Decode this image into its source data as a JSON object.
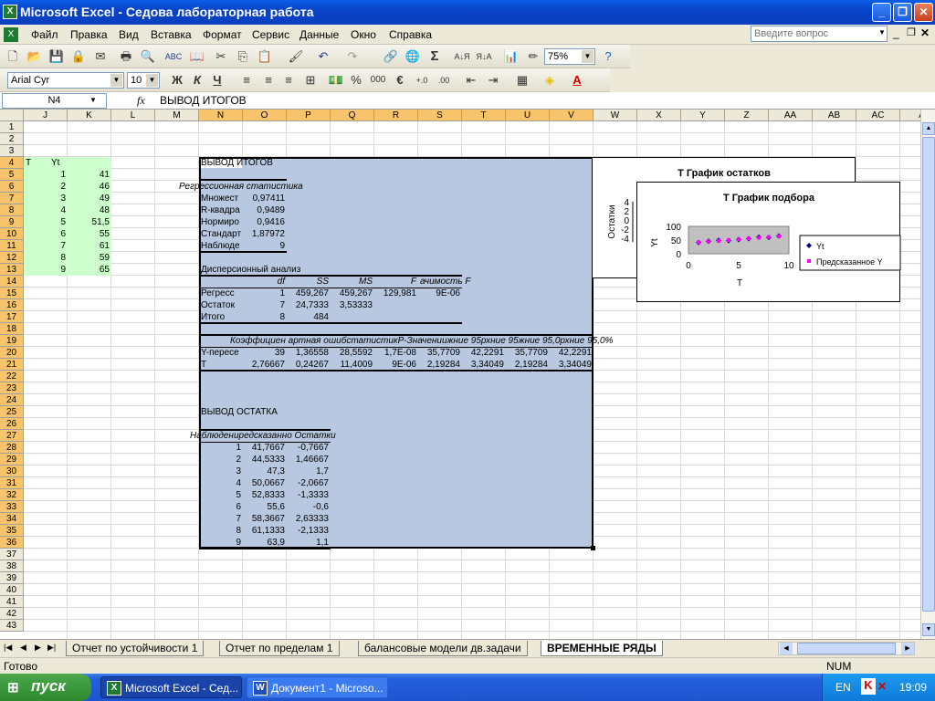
{
  "window": {
    "title": "Microsoft Excel - Седова лабораторная работа"
  },
  "menu": [
    "Файл",
    "Правка",
    "Вид",
    "Вставка",
    "Формат",
    "Сервис",
    "Данные",
    "Окно",
    "Справка"
  ],
  "ask_placeholder": "Введите вопрос",
  "toolbar": {
    "zoom": "75%",
    "font": "Arial Cyr",
    "size": "10",
    "bold": "Ж",
    "italic": "К",
    "underline": "Ч",
    "percent": "%",
    "thousands": "000",
    "euro": "€"
  },
  "formula_bar": {
    "name_box": "N4",
    "fx": "fx",
    "content": "ВЫВОД ИТОГОВ"
  },
  "columns": [
    "J",
    "K",
    "L",
    "M",
    "N",
    "O",
    "P",
    "Q",
    "R",
    "S",
    "T",
    "U",
    "V",
    "W",
    "X",
    "Y",
    "Z",
    "AA",
    "AB",
    "AC",
    "A"
  ],
  "rows": [
    "1",
    "2",
    "3",
    "4",
    "5",
    "6",
    "7",
    "8",
    "9",
    "10",
    "11",
    "12",
    "13",
    "14",
    "15",
    "16",
    "17",
    "18",
    "19",
    "20",
    "21",
    "22",
    "23",
    "24",
    "25",
    "26",
    "27",
    "28",
    "29",
    "30",
    "31",
    "32",
    "33",
    "34",
    "35",
    "36",
    "37",
    "38",
    "39",
    "40",
    "41",
    "42",
    "43"
  ],
  "data_table": {
    "headers": [
      "T",
      "Yt"
    ],
    "T": [
      "1",
      "2",
      "3",
      "4",
      "5",
      "6",
      "7",
      "8",
      "9"
    ],
    "Yt": [
      "41",
      "46",
      "49",
      "48",
      "51,5",
      "55",
      "61",
      "59",
      "65"
    ]
  },
  "output": {
    "title": "ВЫВОД ИТОГОВ",
    "reg_stats_title": "Регрессионная статистика",
    "reg_stats": [
      [
        "Множест",
        "0,97411"
      ],
      [
        "R-квадра",
        "0,9489"
      ],
      [
        "Нормиро",
        "0,9416"
      ],
      [
        "Стандарт",
        "1,87972"
      ],
      [
        "Наблюде",
        "9"
      ]
    ],
    "anova_title": "Дисперсионный анализ",
    "anova_headers": [
      "df",
      "SS",
      "MS",
      "F",
      "ачимость F"
    ],
    "anova_rows": [
      [
        "Регресс",
        "1",
        "459,267",
        "459,267",
        "129,981",
        "9E-06"
      ],
      [
        "Остаток",
        "7",
        "24,7333",
        "3,53333",
        "",
        ""
      ],
      [
        "Итого",
        "8",
        "484",
        "",
        "",
        ""
      ]
    ],
    "coef_headers": "Коэффициен артная ошибстатистикР-Значениижние 95рхние 95жние 95,0рхние 95,0%",
    "coef_rows": [
      [
        "Y-пересе",
        "39",
        "1,36558",
        "28,5592",
        "1,7E-08",
        "35,7709",
        "42,2291",
        "35,7709",
        "42,2291"
      ],
      [
        "T",
        "2,76667",
        "0,24267",
        "11,4009",
        "9E-06",
        "2,19284",
        "3,34049",
        "2,19284",
        "3,34049"
      ]
    ],
    "resid_title": "ВЫВОД ОСТАТКА",
    "resid_header": "Наблюдениредсказанно Остатки",
    "resid_rows": [
      [
        "1",
        "41,7667",
        "-0,7667"
      ],
      [
        "2",
        "44,5333",
        "1,46667"
      ],
      [
        "3",
        "47,3",
        "1,7"
      ],
      [
        "4",
        "50,0667",
        "-2,0667"
      ],
      [
        "5",
        "52,8333",
        "-1,3333"
      ],
      [
        "6",
        "55,6",
        "-0,6"
      ],
      [
        "7",
        "58,3667",
        "2,63333"
      ],
      [
        "8",
        "61,1333",
        "-2,1333"
      ],
      [
        "9",
        "63,9",
        "1,1"
      ]
    ]
  },
  "chart_data": [
    {
      "type": "scatter",
      "title": "T График остатков",
      "ylabel": "Остатки",
      "y_ticks": [
        "4",
        "2",
        "0",
        "-2",
        "-4"
      ]
    },
    {
      "type": "scatter",
      "title": "T График подбора",
      "xlabel": "T",
      "ylabel": "Yt",
      "xlim": [
        0,
        10
      ],
      "ylim": [
        0,
        100
      ],
      "x_ticks": [
        "0",
        "5",
        "10"
      ],
      "y_ticks": [
        "100",
        "50",
        "0"
      ],
      "series": [
        {
          "name": "Yt",
          "color": "#000080",
          "x": [
            1,
            2,
            3,
            4,
            5,
            6,
            7,
            8,
            9
          ],
          "y": [
            41,
            46,
            49,
            48,
            51.5,
            55,
            61,
            59,
            65
          ]
        },
        {
          "name": "Предсказанное Y",
          "color": "#ff00ff",
          "x": [
            1,
            2,
            3,
            4,
            5,
            6,
            7,
            8,
            9
          ],
          "y": [
            41.7667,
            44.5333,
            47.3,
            50.0667,
            52.8333,
            55.6,
            58.3667,
            61.1333,
            63.9
          ]
        }
      ]
    }
  ],
  "sheet_tabs": [
    "Отчет по устойчивости 1",
    "Отчет по пределам 1",
    "балансовые модели дв.задачи",
    "ВРЕМЕННЫЕ РЯДЫ"
  ],
  "status": {
    "ready": "Готово",
    "num": "NUM"
  },
  "taskbar": {
    "start": "пуск",
    "tasks": [
      "Microsoft Excel - Сед...",
      "Документ1 - Microso..."
    ],
    "lang": "EN",
    "clock": "19:09"
  }
}
